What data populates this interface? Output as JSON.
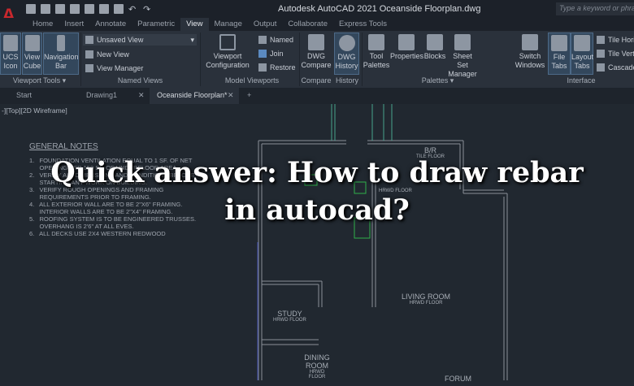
{
  "app": {
    "title": "Autodesk AutoCAD 2021   Oceanside Floorplan.dwg",
    "search_placeholder": "Type a keyword or phrase"
  },
  "ribbon_tabs": [
    "Home",
    "Insert",
    "Annotate",
    "Parametric",
    "View",
    "Manage",
    "Output",
    "Collaborate",
    "Express Tools"
  ],
  "ribbon": {
    "ucs": "UCS Icon",
    "viewcube": "View Cube",
    "navbar": "Navigation Bar",
    "viewport_tools": "Viewport Tools ▾",
    "view_select": "Unsaved View",
    "new_view": "New View",
    "view_manager": "View Manager",
    "named_views": "Named Views",
    "viewport_config": "Viewport Configuration",
    "named": "Named",
    "join": "Join",
    "restore": "Restore",
    "model_viewports": "Model Viewports",
    "dwg_compare": "DWG Compare",
    "compare": "Compare",
    "dwg_history": "DWG History",
    "history": "History",
    "tool_palettes": "Tool Palettes",
    "properties": "Properties",
    "blocks": "Blocks",
    "sheet_set": "Sheet Set Manager",
    "palettes": "Palettes ▾",
    "switch_windows": "Switch Windows",
    "file_tabs": "File Tabs",
    "layout_tabs": "Layout Tabs",
    "tile_h": "Tile Horizontally",
    "tile_v": "Tile Vertically",
    "cascade": "Cascade",
    "interface": "Interface"
  },
  "file_tabs": [
    "Start",
    "Drawing1",
    "Oceanside Floorplan*"
  ],
  "viewport_label": "-][Top][2D Wireframe]",
  "notes": {
    "title": "GENERAL NOTES",
    "items": [
      "1.   FOUNDATION VENTILATION EQUAL TO 1 SF. OF NET",
      "      OPENING PER 150 SF. OF UNDERFLOOR AREA.",
      "2.   VERIFY ALL DIMENSIONS AND CONDITIONS BEFORE",
      "      STARTING ANY WORK ON BUILDING.",
      "3.   VERIFY ROUGH OPENINGS AND FRAMING",
      "      REQUIREMENTS PRIOR TO FRAMING.",
      "4.   ALL EXTERIOR WALL ARE TO BE 2\"X6\" FRAMING.",
      "      INTERIOR WALLS ARE TO BE 2\"X4\" FRAMING.",
      "5.   ROOFING SYSTEM IS TO BE ENGINEERED TRUSSES.",
      "      OVERHANG IS 2'6\" AT ALL EVES.",
      "6.   ALL DECKS USE 2X4 WESTERN REDWOOD"
    ]
  },
  "rooms": {
    "br": "B/R",
    "br_floor": "TILE FLOOR",
    "hrwd": "HRWD FLOOR",
    "living": "LIVING ROOM",
    "living_floor": "HRWD FLOOR",
    "study": "STUDY",
    "study_floor": "HRWD FLOOR",
    "dining": "DINING ROOM",
    "dining_floor": "HRWD FLOOR",
    "forum": "FORUM"
  },
  "headline": {
    "line1": "Quick answer: How to draw rebar",
    "line2": "in autocad?"
  }
}
